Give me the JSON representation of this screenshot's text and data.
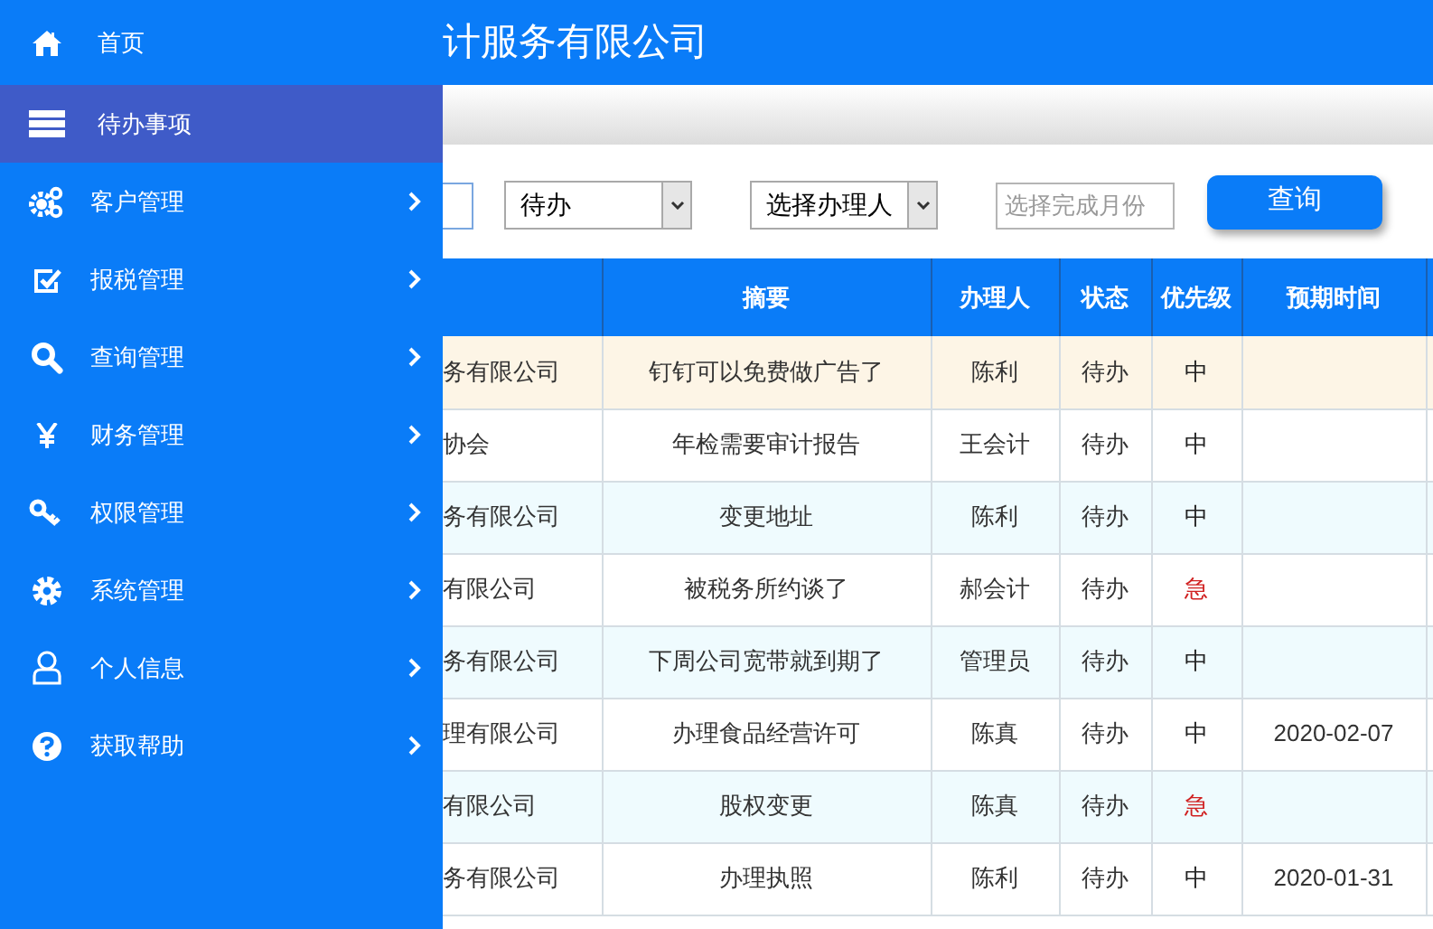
{
  "header": {
    "title": "计服务有限公司"
  },
  "sidebar": {
    "items": [
      {
        "label": "首页",
        "selected": false,
        "has_submenu": false
      },
      {
        "label": "待办事项",
        "selected": true,
        "has_submenu": false
      },
      {
        "label": "客户管理",
        "selected": false,
        "has_submenu": true
      },
      {
        "label": "报税管理",
        "selected": false,
        "has_submenu": true
      },
      {
        "label": "查询管理",
        "selected": false,
        "has_submenu": true
      },
      {
        "label": "财务管理",
        "selected": false,
        "has_submenu": true
      },
      {
        "label": "权限管理",
        "selected": false,
        "has_submenu": true
      },
      {
        "label": "系统管理",
        "selected": false,
        "has_submenu": true
      },
      {
        "label": "个人信息",
        "selected": false,
        "has_submenu": true
      },
      {
        "label": "获取帮助",
        "selected": false,
        "has_submenu": true
      }
    ]
  },
  "filters": {
    "status_select": "待办",
    "handler_select": "选择办理人",
    "month": {
      "placeholder": "选择完成月份"
    },
    "query_button": "查询"
  },
  "table": {
    "columns": [
      "摘要",
      "办理人",
      "状态",
      "优先级",
      "预期时间"
    ],
    "rows": [
      {
        "column_1": "务有限公司",
        "summary": "钉钉可以免费做广告了",
        "handler": "陈利",
        "status": "待办",
        "priority": "中",
        "urgent": false,
        "due": "",
        "selected": true
      },
      {
        "column_1": "协会",
        "summary": "年检需要审计报告",
        "handler": "王会计",
        "status": "待办",
        "priority": "中",
        "urgent": false,
        "due": "",
        "selected": false
      },
      {
        "column_1": "务有限公司",
        "summary": "变更地址",
        "handler": "陈利",
        "status": "待办",
        "priority": "中",
        "urgent": false,
        "due": "",
        "selected": false
      },
      {
        "column_1": "有限公司",
        "summary": "被税务所约谈了",
        "handler": "郝会计",
        "status": "待办",
        "priority": "急",
        "urgent": true,
        "due": "",
        "selected": false
      },
      {
        "column_1": "务有限公司",
        "summary": "下周公司宽带就到期了",
        "handler": "管理员",
        "status": "待办",
        "priority": "中",
        "urgent": false,
        "due": "",
        "selected": false
      },
      {
        "column_1": "理有限公司",
        "summary": "办理食品经营许可",
        "handler": "陈真",
        "status": "待办",
        "priority": "中",
        "urgent": false,
        "due": "2020-02-07",
        "selected": false
      },
      {
        "column_1": "有限公司",
        "summary": "股权变更",
        "handler": "陈真",
        "status": "待办",
        "priority": "急",
        "urgent": true,
        "due": "",
        "selected": false
      },
      {
        "column_1": "务有限公司",
        "summary": "办理执照",
        "handler": "陈利",
        "status": "待办",
        "priority": "中",
        "urgent": false,
        "due": "2020-01-31",
        "selected": false
      }
    ]
  }
}
